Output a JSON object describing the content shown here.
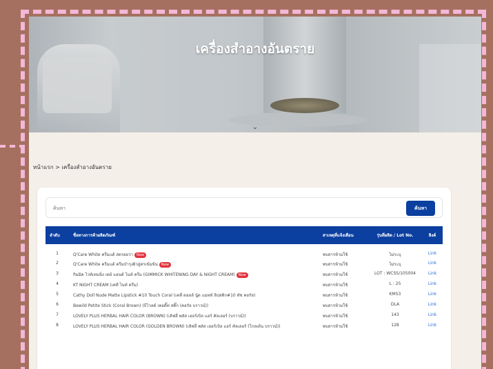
{
  "hero": {
    "title": "เครื่องสำอางอันตราย"
  },
  "breadcrumb": "หน้าแรก > เครื่องสำอางอันตราย",
  "search": {
    "placeholder": "ค้นหา",
    "button_label": "ค้นหา"
  },
  "table": {
    "headers": [
      "ลำดับ",
      "ชื่อทางการค้าผลิตภัณฑ์",
      "สาเหตุที่แจ้งเตือน",
      "รุ่นที่ผลิต / Lot No.",
      "ลิงค์"
    ],
    "rows": [
      {
        "no": "1",
        "name": "Q'Care White ครีมแต้ สตรอยว่า",
        "new": "New",
        "reason": "พบสารห้ามใช้",
        "lot": "ไม่ระบุ",
        "link": "Link"
      },
      {
        "no": "2",
        "name": "Q'Care White ครีมแต้ ครีมบำรุงผิวสูตรเข้มข้น",
        "new": "New",
        "reason": "พบสารห้ามใช้",
        "lot": "ไม่ระบุ",
        "link": "Link"
      },
      {
        "no": "3",
        "name": "กิมมิค ไวท์เทนนิ่ง เดย์ แอนด์ ไนท์ ครีม (GIMMICK WHITENING DAY & NIGHT CREAM)",
        "new": "New",
        "reason": "พบสารห้ามใช้",
        "lot": "LOT : WCSS/105004",
        "link": "Link"
      },
      {
        "no": "4",
        "name": "KT NIGHT CREAM (เคที ไนท์ ครีม)",
        "new": "",
        "reason": "พบสารห้ามใช้",
        "lot": "L : 25",
        "link": "Link"
      },
      {
        "no": "5",
        "name": "Cathy Doll Nude Matte Lipstick #10 Touch Coral (เคที่ ดอลล์ นู้ด แมทท์ ลิปสติก#10 ทัช คอรัล)",
        "new": "",
        "reason": "พบสารห้ามใช้",
        "lot": "KMS3",
        "link": "Link"
      },
      {
        "no": "6",
        "name": "Bewild Petite Stick (Coral Brown) (บีไวลด์ เพอติ๊ท สติ๊ก (คอรัล บราวน์))",
        "new": "",
        "reason": "พบสารห้ามใช้",
        "lot": "DLA",
        "link": "Link"
      },
      {
        "no": "7",
        "name": "LOVELY PLUS HERBAL HAIR COLOR (BROWN) (เลิฟลี่ พลัส เฮอร์เบิล แฮร์ คัลเลอร์ (บราวน์))",
        "new": "",
        "reason": "พบสารห้ามใช้",
        "lot": "143",
        "link": "Link"
      },
      {
        "no": "8",
        "name": "LOVELY PLUS HERBAL HAIR COLOR (GOLDEN BROWN) (เลิฟลี่ พลัส เฮอร์เบิล แฮร์ คัลเลอร์ (โกลเด้น บราวน์))",
        "new": "",
        "reason": "พบสารห้ามใช้",
        "lot": "128",
        "link": "Link"
      }
    ]
  },
  "colors": {
    "frame_bg": "#a67060",
    "dash": "#f3b8d8",
    "header_blue": "#0b3fa0",
    "badge_red": "#e2323c",
    "link_blue": "#2b6bd6"
  }
}
